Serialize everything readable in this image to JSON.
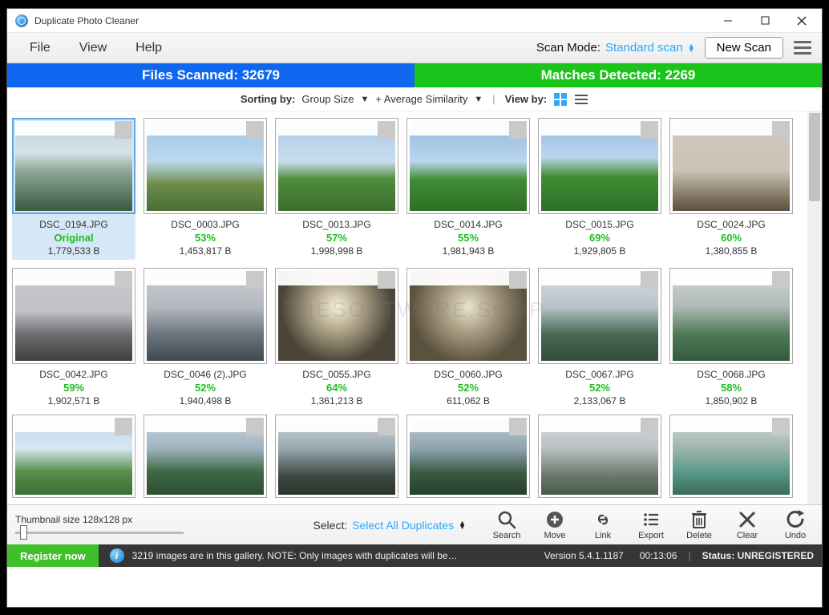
{
  "window": {
    "title": "Duplicate Photo Cleaner"
  },
  "menu": {
    "file": "File",
    "view": "View",
    "help": "Help"
  },
  "scanmode": {
    "label": "Scan Mode:",
    "value": "Standard scan"
  },
  "newscan": "New Scan",
  "stats": {
    "scanned": "Files Scanned: 32679",
    "matches": "Matches Detected: 2269"
  },
  "sorting": {
    "prefix": "Sorting by:",
    "primary": "Group Size",
    "secondary": "+ Average Similarity",
    "viewby": "View by:"
  },
  "thumbs": [
    {
      "file": "DSC_0194.JPG",
      "similarity": "Original",
      "size": "1,779,533 B",
      "selected": true,
      "bg": "linear-gradient(to bottom, #bcd4e2 0%, #d6e2e6 35%, #8fa79a 55%, #3b5a3f 100%)"
    },
    {
      "file": "DSC_0003.JPG",
      "similarity": "53%",
      "size": "1,453,817 B",
      "bg": "linear-gradient(to bottom, #9fc6e8 0%, #bcd8ee 45%, #6d8e4a 70%, #4a6d36 100%)"
    },
    {
      "file": "DSC_0013.JPG",
      "similarity": "57%",
      "size": "1,998,998 B",
      "bg": "linear-gradient(to bottom, #a7c9e9 0%, #cbddee 45%, #4f8c3b 65%, #3a6e2e 100%)"
    },
    {
      "file": "DSC_0014.JPG",
      "similarity": "55%",
      "size": "1,981,943 B",
      "bg": "linear-gradient(to bottom, #8fb7df 0%, #bcd6ee 45%, #3f8d33 65%, #2f6f27 100%)"
    },
    {
      "file": "DSC_0015.JPG",
      "similarity": "69%",
      "size": "1,929,805 B",
      "bg": "linear-gradient(to bottom, #8fb7df 0%, #bcd6ee 40%, #3f8d33 62%, #2f6f27 100%)"
    },
    {
      "file": "DSC_0024.JPG",
      "similarity": "60%",
      "size": "1,380,855 B",
      "bg": "linear-gradient(to bottom, #cfc9bf 0%, #cbc3b5 55%, #7f735f 85%, #5a4f3f 100%)"
    },
    {
      "file": "DSC_0042.JPG",
      "similarity": "59%",
      "size": "1,902,571 B",
      "bg": "linear-gradient(to bottom, #c6c8cc 0%, #bfc1c5 45%, #6c6e70 70%, #3e3f41 100%)"
    },
    {
      "file": "DSC_0046 (2).JPG",
      "similarity": "52%",
      "size": "1,940,498 B",
      "bg": "linear-gradient(to bottom, #c8cbd0 0%, #b5b9bf 40%, #6d7680 70%, #3e4a4f 100%)"
    },
    {
      "file": "DSC_0055.JPG",
      "similarity": "64%",
      "size": "1,361,213 B",
      "bg": "radial-gradient(circle at 50% 40%, #f5eedb 0%, #b0a58a 30%, #4a4538 70%)"
    },
    {
      "file": "DSC_0060.JPG",
      "similarity": "52%",
      "size": "611,062 B",
      "bg": "radial-gradient(circle at 50% 40%, #e9e2cf 0%, #a89c82 32%, #5a513f 72%)"
    },
    {
      "file": "DSC_0067.JPG",
      "similarity": "52%",
      "size": "2,133,067 B",
      "bg": "linear-gradient(to bottom, #d8dce0 0%, #b7c3c9 40%, #4a6b55 70%, #2f4d3a 100%)"
    },
    {
      "file": "DSC_0068.JPG",
      "similarity": "58%",
      "size": "1,850,902 B",
      "bg": "linear-gradient(to bottom, #d4d8db 0%, #aeb9b5 40%, #4f7a56 70%, #345a3d 100%)"
    },
    {
      "file": "",
      "similarity": "",
      "size": "",
      "partial": true,
      "bg": "linear-gradient(to bottom, #bcd6ee 0%, #d6e6f2 40%, #5a8e4a 70%, #3a6e36 100%)"
    },
    {
      "file": "",
      "similarity": "",
      "size": "",
      "partial": true,
      "bg": "linear-gradient(to bottom, #c6d6e2 0%, #9fb3bf 40%, #3f6a45 70%, #2c4d32 100%)"
    },
    {
      "file": "",
      "similarity": "",
      "size": "",
      "partial": true,
      "bg": "linear-gradient(to bottom, #cdd5db 0%, #9aa8b0 40%, #3f4a42 75%, #2a342e 100%)"
    },
    {
      "file": "",
      "similarity": "",
      "size": "",
      "partial": true,
      "bg": "linear-gradient(to bottom, #bfcdd6 0%, #8fa3ae 40%, #385a3f 72%, #263f2c 100%)"
    },
    {
      "file": "",
      "similarity": "",
      "size": "",
      "partial": true,
      "bg": "linear-gradient(to bottom, #d8dde0 0%, #b8c0c2 40%, #6a7a6a 75%, #4a5a4a 100%)"
    },
    {
      "file": "",
      "similarity": "",
      "size": "",
      "partial": true,
      "bg": "linear-gradient(to bottom, #d2d8d6 0%, #9fb5aa 40%, #5a9a8a 70%, #3a6a5a 100%)"
    }
  ],
  "lower": {
    "thumbsize": "Thumbnail size 128x128 px",
    "select_label": "Select:",
    "select_value": "Select All Duplicates"
  },
  "tools": {
    "search": "Search",
    "move": "Move",
    "link": "Link",
    "export": "Export",
    "delete": "Delete",
    "clear": "Clear",
    "undo": "Undo"
  },
  "status": {
    "register": "Register now",
    "message": "3219 images are in this gallery. NOTE: Only images with duplicates will be…",
    "version": "Version 5.4.1.1187",
    "time": "00:13:06",
    "status_label": "Status: UNREGISTERED"
  },
  "watermark": "THESOFTWARE.SHOP"
}
